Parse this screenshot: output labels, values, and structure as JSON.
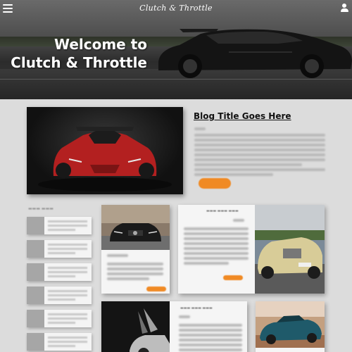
{
  "header": {
    "brand": "Clutch & Throttle",
    "menu_icon": "hamburger-menu-icon",
    "user_icon": "user-account-icon"
  },
  "hero": {
    "title_line1": "Welcome to",
    "title_line2": "Clutch & Throttle"
  },
  "featured": {
    "title": "Blog Title Goes Here"
  },
  "colors": {
    "accent": "#f08a24",
    "page_bg": "#dcdcdc",
    "card_bg": "#f5f5f5",
    "thumb_gray": "#a6a6a6"
  }
}
